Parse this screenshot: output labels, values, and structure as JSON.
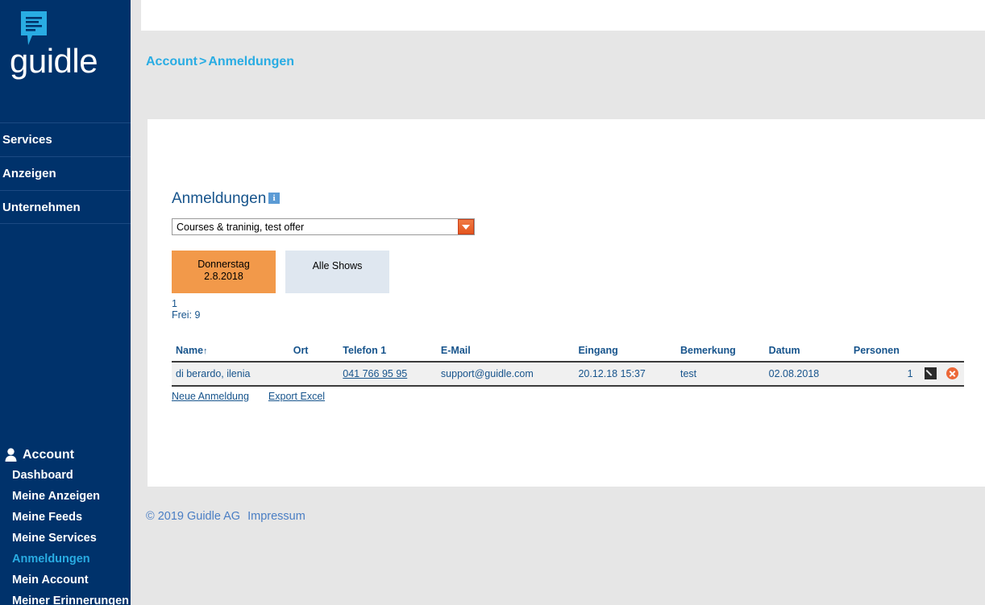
{
  "brand": {
    "name": "guidle",
    "logo_icon": "speech-bubble-lines-icon",
    "colors": {
      "sidebar_bg": "#00326b",
      "accent_cyan": "#29ace3",
      "accent_orange": "#f2994a",
      "link_blue": "#17548c"
    }
  },
  "sidebar": {
    "top_items": [
      {
        "label": "Services"
      },
      {
        "label": "Anzeigen"
      },
      {
        "label": "Unternehmen"
      }
    ],
    "account": {
      "icon": "person-icon",
      "label": "Account",
      "items": [
        {
          "label": "Dashboard",
          "active": false
        },
        {
          "label": "Meine Anzeigen",
          "active": false
        },
        {
          "label": "Meine Feeds",
          "active": false
        },
        {
          "label": "Meine Services",
          "active": false
        },
        {
          "label": "Anmeldungen",
          "active": true
        },
        {
          "label": "Mein Account",
          "active": false
        },
        {
          "label": "Meiner Erinnerungen",
          "active": false
        }
      ]
    }
  },
  "breadcrumb": {
    "parent": "Account",
    "separator": ">",
    "current": "Anmeldungen"
  },
  "main": {
    "title": "Anmeldungen",
    "info_icon_label": "i",
    "offer_select": {
      "value": "Courses & traninig, test offer",
      "arrow_icon": "chevron-down-icon"
    },
    "show_tabs": [
      {
        "line1": "Donnerstag",
        "line2": "2.8.2018",
        "selected": true
      },
      {
        "line1": "Alle Shows",
        "line2": "",
        "selected": false
      }
    ],
    "tab_meta": {
      "count": "1",
      "free": "Frei: 9"
    },
    "table": {
      "headers": [
        "Name",
        "Ort",
        "Telefon 1",
        "E-Mail",
        "Eingang",
        "Bemerkung",
        "Datum",
        "Personen",
        ""
      ],
      "sort_indicator": "↑",
      "rows": [
        {
          "name": "di berardo, ilenia",
          "ort": "",
          "telefon": "041 766 95 95",
          "email": "support@guidle.com",
          "eingang": "20.12.18 15:37",
          "bemerkung": "test",
          "datum": "02.08.2018",
          "personen": "1",
          "edit_icon": "pencil-icon",
          "delete_icon": "delete-circle-icon"
        }
      ]
    },
    "actions": [
      {
        "label": "Neue Anmeldung"
      },
      {
        "label": "Export Excel"
      }
    ]
  },
  "footer": {
    "copyright": "© 2019 Guidle AG",
    "imprint": "Impressum"
  }
}
